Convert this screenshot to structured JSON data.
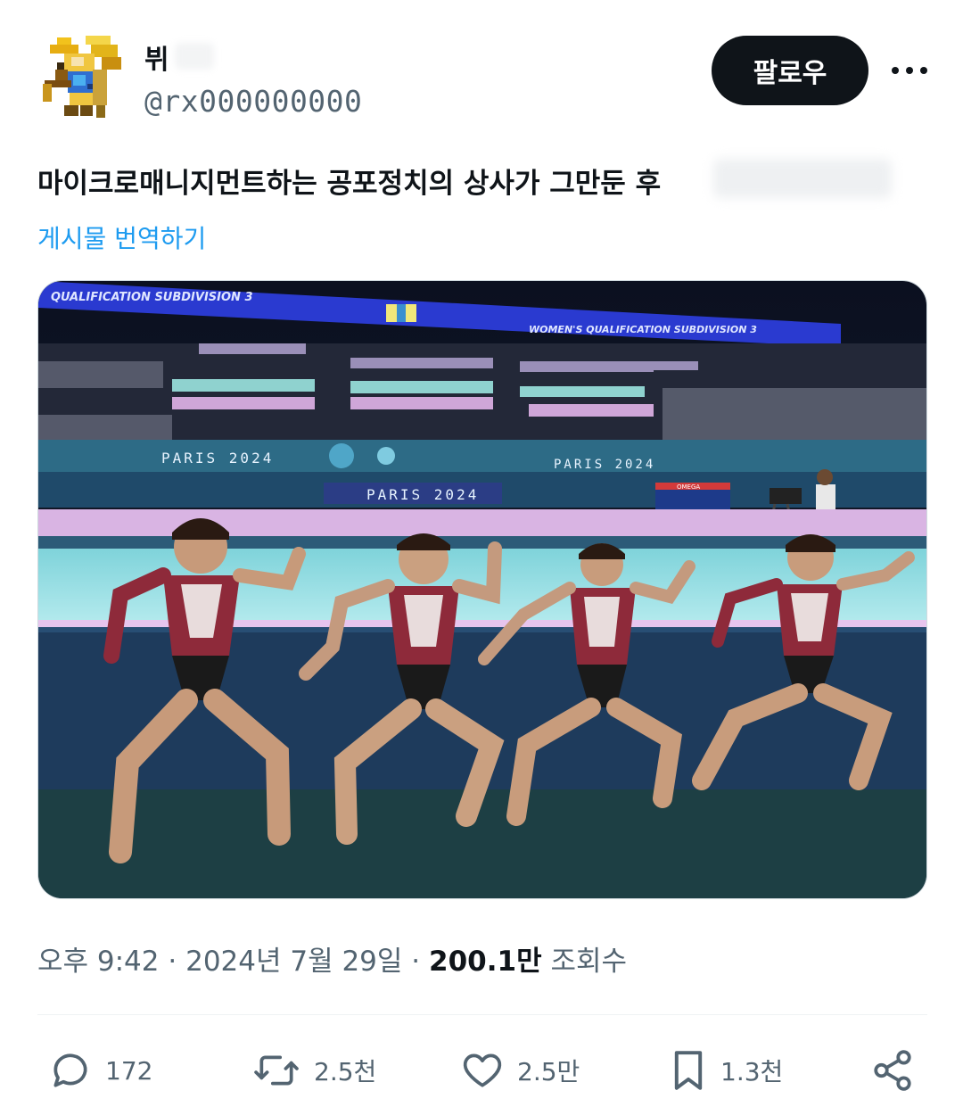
{
  "author": {
    "display_name": "뷔",
    "handle": "@rx000000000"
  },
  "follow_button": {
    "label": "팔로우"
  },
  "more_icon": "more-horizontal-icon",
  "tweet": {
    "text": "마이크로매니지먼트하는 공포정치의 상사가 그만둔 후",
    "translate_label": "게시물 번역하기"
  },
  "media": {
    "banner_text_1": "QUALIFICATION SUBDIVISION 3",
    "banner_text_2": "WOMEN'S QUALIFICATION SUBDIVISION 3",
    "venue_text_1": "PARIS 2024",
    "venue_text_2": "PARIS 2024",
    "venue_text_3": "PARIS 2024",
    "scoreboard_text": "OMEGA"
  },
  "meta": {
    "time": "오후 9:42",
    "separator": "·",
    "date": "2024년 7월 29일",
    "views_count": "200.1만",
    "views_label": "조회수"
  },
  "actions": {
    "reply": {
      "icon": "reply-icon",
      "count": "172"
    },
    "repost": {
      "icon": "repost-icon",
      "count": "2.5천"
    },
    "like": {
      "icon": "heart-icon",
      "count": "2.5만"
    },
    "bookmark": {
      "icon": "bookmark-icon",
      "count": "1.3천"
    },
    "share": {
      "icon": "share-icon"
    }
  },
  "colors": {
    "text_primary": "#0f1419",
    "text_secondary": "#536471",
    "link": "#1d9bf0",
    "follow_bg": "#0f1419"
  }
}
